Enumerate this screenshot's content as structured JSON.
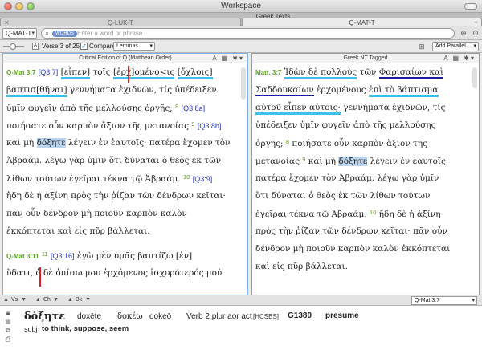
{
  "window": {
    "title": "Workspace"
  },
  "tabs": {
    "workspace_label": "Greek Texts",
    "items": [
      {
        "label": "Q-LUK-T"
      },
      {
        "label": "Q-MAT-T"
      }
    ]
  },
  "search": {
    "reference": "Q-MAT-T",
    "chip": "WORDS",
    "placeholder": "Enter a word or phrase"
  },
  "options": {
    "verse_counter": "Verse 3 of 254",
    "compare_label": "Compare",
    "compare_checked": true,
    "mode_select": "Lemmas",
    "add_parallel": "Add Parallel"
  },
  "left_pane": {
    "title": "Critical Edition of Q (Matthean Order)",
    "ref1": "Q-Mat 3:7",
    "ref2": "Q-Mat 3:11",
    "tags": {
      "q37": "[Q3:7]",
      "q38a": "[Q3:8a]",
      "q38b": "[Q3:8b]",
      "q39": "[Q3:9]",
      "q316": "[Q3:16]"
    },
    "verse_nums": {
      "v8": "8",
      "v9": "9",
      "v10": "10",
      "v11": "11"
    },
    "words": {
      "eipen": "[εἶπεν]",
      "tois": "τοῖς",
      "erchomenois": "[ἐρχ]ομένο<ις",
      "ochlois": "[ὄχλοις]",
      "baptisthenai": "βαπτισ[θῆναι]",
      "doxete": "δόξητε",
      "en": "[ἐν]"
    },
    "lines": {
      "l2b": " γεννήματα ἐχιδνῶν, τίς ὑπέδειξεν",
      "l3": "ὑμῖν φυγεῖν ἀπὸ τῆς μελλούσης ὀργῆς;",
      "l4": "ποιήσατε οὖν καρπὸν ἄξιον τῆς μετανοίας",
      "l5a": "καὶ μὴ ",
      "l5b": " λέγειν ἐν ἑαυτοῖς· πατέρα ἔχομεν τὸν",
      "l6": "Ἀβραάμ. λέγω γὰρ ὑμῖν ὅτι δύναται ὁ θεὸς ἐκ τῶν",
      "l7": "λίθων τούτων ἐγεῖραι τέκνα τῷ Ἀβραάμ.",
      "l8": "ἤδη δὲ ἡ ἀξίνη πρὸς τὴν ῥίζαν τῶν δένδρων κεῖται·",
      "l9": "πᾶν οὖν δένδρον μὴ ποιοῦν καρπὸν καλὸν",
      "l10": "ἐκκόπτεται καὶ εἰς πῦρ βάλλεται.",
      "l11": " ἐγὼ μὲν ὑμᾶς βαπτίζω ",
      "l12a": "ὕδατι,",
      "l12b": " ὁ δὲ ὀπίσω μου ἐρχόμενος ἰσχυρότερός μού"
    }
  },
  "right_pane": {
    "title": "Greek NT Tagged",
    "ref1": "Matt. 3:7",
    "verse_nums": {
      "v8": "8",
      "v9": "9",
      "v10": "10"
    },
    "words": {
      "idon": "Ἰδὼν δὲ πολλοὺς",
      "ton": "τῶν",
      "pharisaion": "Φαρισαίων καὶ",
      "saddoukaion": "Σαδδουκαίων",
      "erchomenous": "ἐρχομένους",
      "epi": "ἐπὶ τὸ βάπτισμα",
      "autou": "αὐτοῦ εἶπεν αὐτοῖς·",
      "doxete": "δόξητε"
    },
    "lines": {
      "l3b": " γεννήματα ἐχιδνῶν, τίς",
      "l4": "ὑπέδειξεν ὑμῖν φυγεῖν ἀπὸ τῆς μελλούσης",
      "l5": "ὀργῆς;",
      "l5b": " ποιήσατε οὖν καρπὸν ἄξιον τῆς",
      "l6": "μετανοίας ",
      "l6b": " καὶ μὴ ",
      "l6c": " λέγειν ἐν ἑαυτοῖς·",
      "l7": "πατέρα ἔχομεν τὸν Ἀβραάμ. λέγω γὰρ ὑμῖν",
      "l8": "ὅτι δύναται ὁ θεὸς ἐκ τῶν λίθων τούτων",
      "l9": "ἐγεῖραι τέκνα τῷ Ἀβραάμ.",
      "l9b": " ἤδη δὲ ἡ ἀξίνη",
      "l10": "πρὸς τὴν ῥίζαν τῶν δένδρων κεῖται· πᾶν οὖν",
      "l11": "δένδρον μὴ ποιοῦν καρπὸν καλὸν ἐκκόπτεται",
      "l12": "καὶ εἰς πῦρ βάλλεται."
    }
  },
  "nav": {
    "vs": "Vs",
    "ch": "Ch",
    "bk": "Bk",
    "reference": "Q-Mat 3:7"
  },
  "lexicon": {
    "word": "δόξητε",
    "translit": "doxēte",
    "lemma": "δοκέω",
    "lemma_translit": "dokeō",
    "morph": "Verb 2 plur aor act",
    "source": "[HCSBS]",
    "strongs": "G1380",
    "gloss": "presume",
    "subj": "subj",
    "definition": "to think, suppose, seem"
  },
  "colors": {
    "verse_ref": "#5a9e1f",
    "q_tag": "#2a36b8",
    "highlight": "#b9d4ee",
    "underline_cyan": "#3dc0ea",
    "underline_navy": "#1c1c9c",
    "cursor_red": "#e02020"
  }
}
